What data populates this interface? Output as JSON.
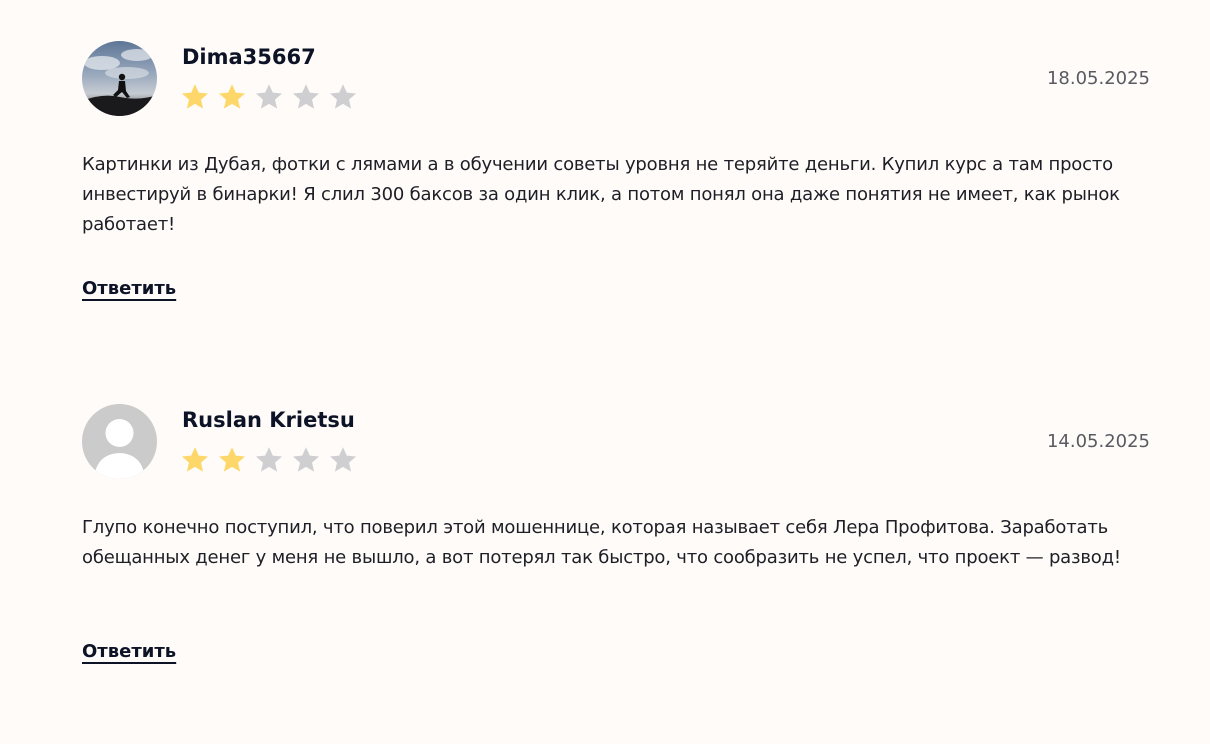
{
  "colors": {
    "background": "#fefbf8",
    "star_filled": "#fdd76a",
    "star_empty": "#cfcfd2",
    "text": "#1e1e26",
    "author": "#0d1326",
    "date": "#5a5a62"
  },
  "reviews": [
    {
      "author": "Dima35667",
      "date": "18.05.2025",
      "rating": 2,
      "max_rating": 5,
      "avatar_icon": "photo-avatar-icon",
      "text": "Картинки из Дубая, фотки с лямами а в обучении советы уровня не теряйте деньги. Купил курс а там просто инвестируй в бинарки! Я слил 300 баксов за один клик, а потом понял она даже понятия не имеет, как рынок работает!",
      "reply_label": "Ответить"
    },
    {
      "author": "Ruslan Krietsu",
      "date": "14.05.2025",
      "rating": 2,
      "max_rating": 5,
      "avatar_icon": "default-user-avatar-icon",
      "text": "Глупо конечно поступил, что поверил этой мошеннице, которая называет себя Лера Профитова. Заработать обещанных денег у меня не вышло, а вот потерял так быстро, что сообразить не успел, что проект — развод!",
      "reply_label": "Ответить"
    }
  ]
}
